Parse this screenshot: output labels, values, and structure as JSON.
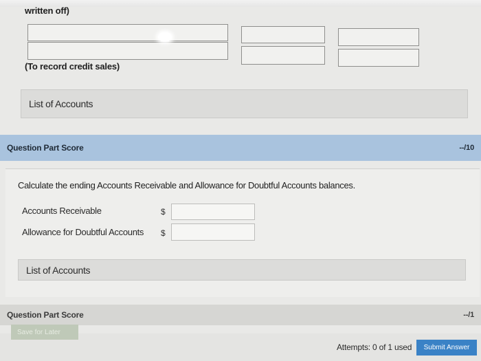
{
  "journal": {
    "note_top": "written off)",
    "note_credit": "(To record credit sales)"
  },
  "part1": {
    "list_of_accounts": "List of Accounts",
    "score_label": "Question Part Score",
    "score_points": "--/10"
  },
  "part2": {
    "instruction": "Calculate the ending Accounts Receivable and Allowance for Doubtful Accounts balances.",
    "rows": [
      {
        "label": "Accounts Receivable",
        "currency": "$",
        "value": ""
      },
      {
        "label": "Allowance for Doubtful Accounts",
        "currency": "$",
        "value": ""
      }
    ],
    "list_of_accounts": "List of Accounts",
    "score_label": "Question Part Score",
    "score_points": "--/1"
  },
  "footer": {
    "save_label": "Save for Later",
    "attempts": "Attempts: 0 of 1 used",
    "submit_label": "Submit Answer"
  },
  "colors": {
    "score_bar_blue": "#a9c3de",
    "submit_blue": "#3a82c6"
  }
}
